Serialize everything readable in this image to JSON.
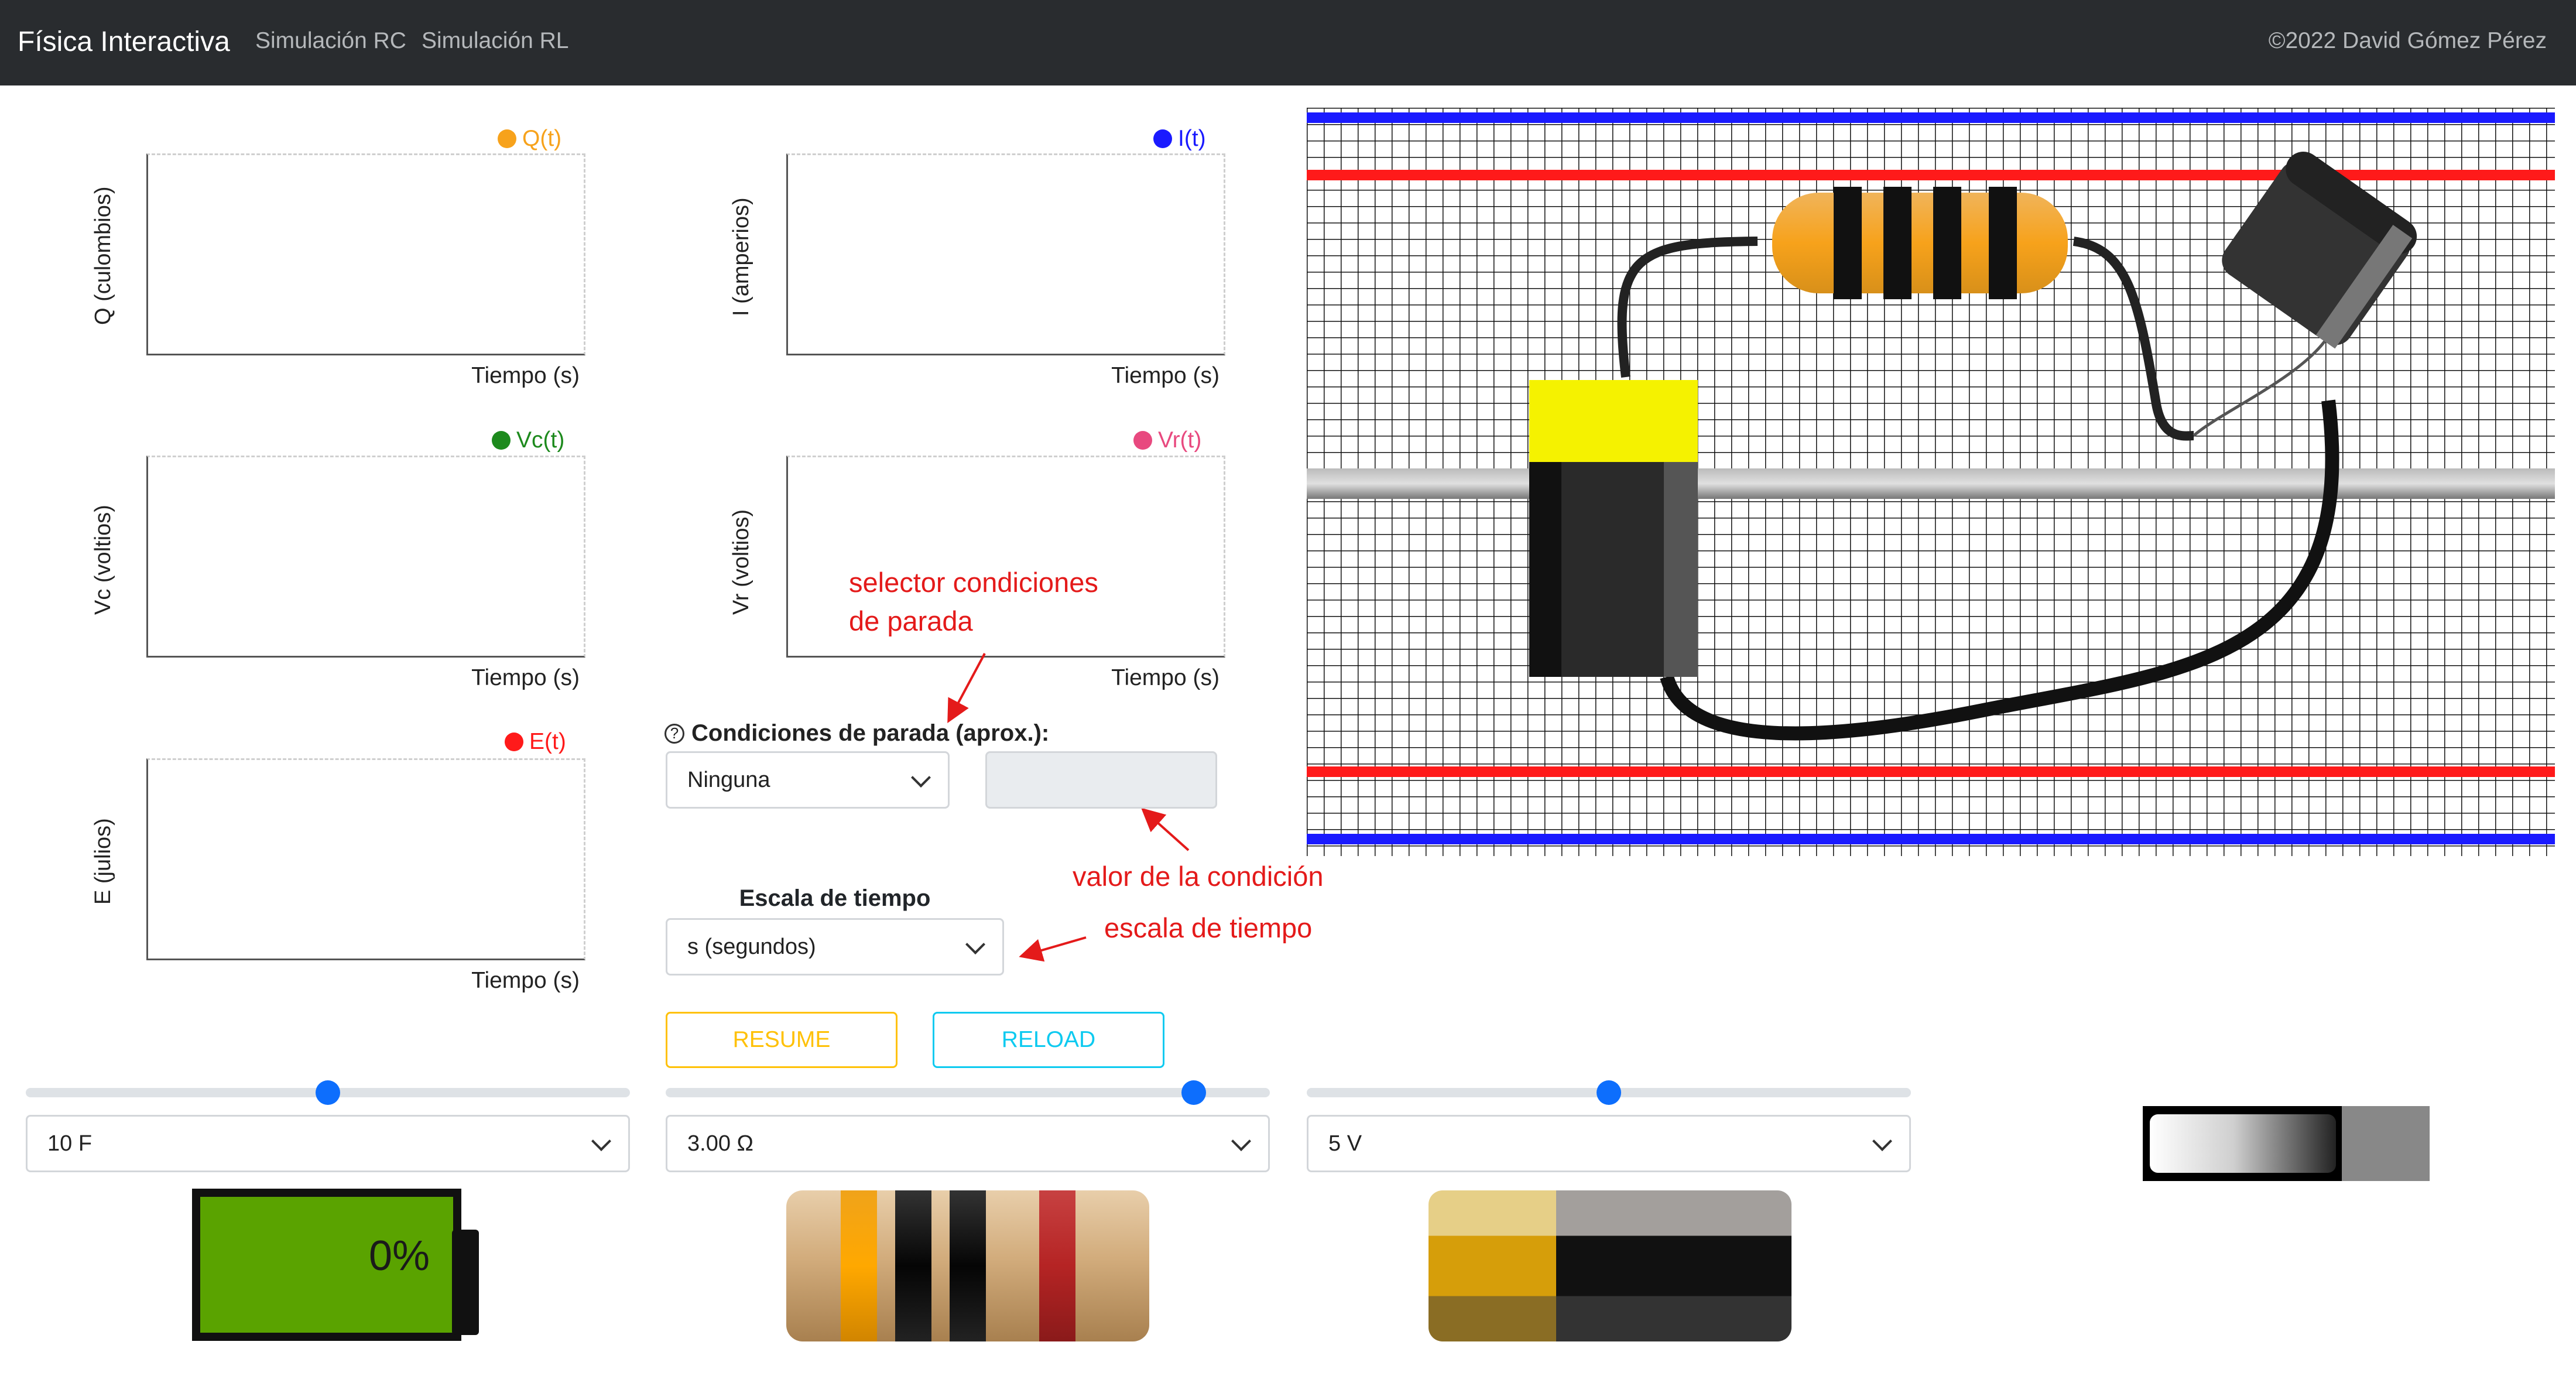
{
  "navbar": {
    "brand": "Física Interactiva",
    "links": [
      "Simulación RC",
      "Simulación RL"
    ],
    "copyright": "©2022 David Gómez Pérez"
  },
  "charts": [
    {
      "legend": "Q(t)",
      "color": "#f7a21b",
      "ylabel": "Q (culombios)",
      "xlabel": "Tiempo (s)"
    },
    {
      "legend": "I(t)",
      "color": "#1a1aff",
      "ylabel": "I (amperios)",
      "xlabel": "Tiempo (s)"
    },
    {
      "legend": "Vc(t)",
      "color": "#1d8a1d",
      "ylabel": "Vc (voltios)",
      "xlabel": "Tiempo (s)"
    },
    {
      "legend": "Vr(t)",
      "color": "#e8497f",
      "ylabel": "Vr (voltios)",
      "xlabel": "Tiempo (s)"
    },
    {
      "legend": "E(t)",
      "color": "#ff1a1a",
      "ylabel": "E (julios)",
      "xlabel": "Tiempo (s)"
    }
  ],
  "annotations": {
    "selector": [
      "selector condiciones",
      "de parada"
    ],
    "valor": "valor de la condición",
    "escala": "escala de tiempo"
  },
  "stop_conditions": {
    "help_icon": "?",
    "label": "Condiciones de parada (aprox.):",
    "selected": "Ninguna",
    "value": ""
  },
  "time_scale": {
    "label": "Escala de tiempo",
    "selected": "s (segundos)"
  },
  "buttons": {
    "resume": "RESUME",
    "reload": "RELOAD"
  },
  "colors": {
    "resume": "#ffc107",
    "reload": "#0dcaf0",
    "slider": "#0d6efd"
  },
  "sliders": [
    {
      "name": "capacitance",
      "selected": "10 F",
      "level": 0.5
    },
    {
      "name": "resistance",
      "selected": "3.00 Ω",
      "level": 0.87
    },
    {
      "name": "voltage",
      "selected": "5 V",
      "level": 0.5
    }
  ],
  "capacitor_charge": {
    "percent": "0%"
  },
  "icons": [
    "battery-charge-icon",
    "resistor-bands-icon",
    "battery-icon",
    "switch-icon",
    "chevron-down-icon",
    "help-icon"
  ]
}
